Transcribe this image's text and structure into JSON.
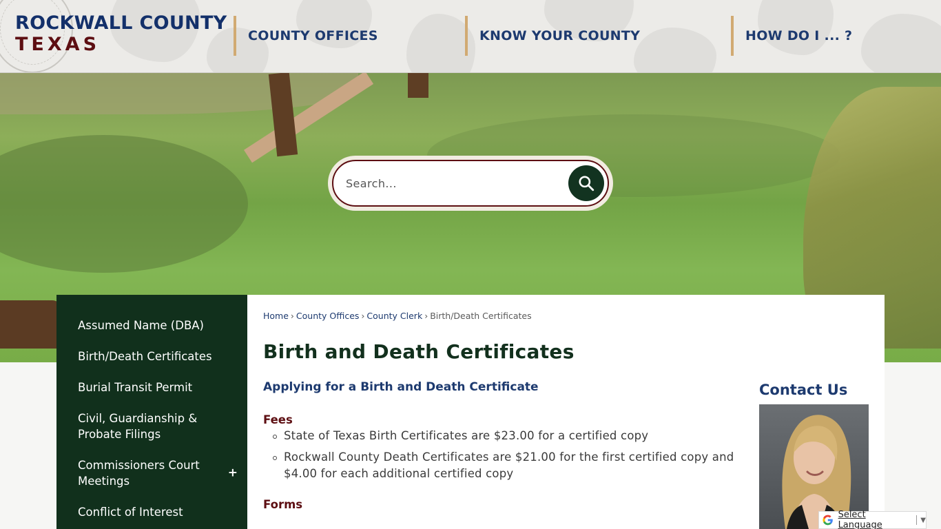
{
  "brand": {
    "line1": "ROCKWALL COUNTY",
    "line2": "TEXAS"
  },
  "nav": [
    {
      "label": "COUNTY OFFICES"
    },
    {
      "label": "KNOW YOUR COUNTY"
    },
    {
      "label": "HOW DO I ... ?"
    }
  ],
  "search": {
    "placeholder": "Search..."
  },
  "sidebar": {
    "items": [
      {
        "label": "Assumed Name (DBA)"
      },
      {
        "label": "Birth/Death Certificates"
      },
      {
        "label": "Burial Transit Permit"
      },
      {
        "label": "Civil, Guardianship & Probate Filings"
      },
      {
        "label": "Commissioners Court Meetings",
        "expand": "+"
      },
      {
        "label": "Conflict of Interest"
      }
    ]
  },
  "breadcrumb": {
    "items": [
      "Home",
      "County Offices",
      "County Clerk"
    ],
    "current": "Birth/Death Certificates",
    "separator": "›"
  },
  "content": {
    "title": "Birth and Death Certificates",
    "subhead": "Applying for a Birth and Death Certificate",
    "fees_heading": "Fees",
    "fees": [
      "State of Texas Birth Certificates are $23.00 for a certified copy",
      "Rockwall County Death Certificates are $21.00 for the first certified copy and $4.00 for each additional certified copy"
    ],
    "forms_heading": "Forms"
  },
  "contact": {
    "heading": "Contact Us"
  },
  "translate": {
    "label": "Select Language",
    "arrow": "▼"
  },
  "colors": {
    "navy": "#1d3a6f",
    "maroon": "#5d0e12",
    "forest": "#11301c",
    "tan_accent": "#d1aa72"
  },
  "icons": {
    "search": "search-icon",
    "google": "google-icon",
    "expand": "plus-icon"
  }
}
